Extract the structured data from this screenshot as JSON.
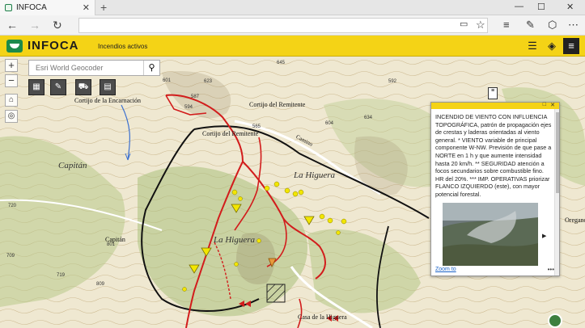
{
  "browser": {
    "tab_title": "INFOCA",
    "tab_close": "✕",
    "new_tab": "+",
    "window_controls": [
      "—",
      "☐",
      "✕"
    ],
    "nav_back": "←",
    "nav_forward": "→",
    "nav_refresh": "↻",
    "url": "",
    "toolbar_icons": [
      "reading-view-icon",
      "favorites-star-icon",
      "hub-icon",
      "notes-icon",
      "share-icon",
      "more-icon"
    ]
  },
  "app": {
    "title": "INFOCA",
    "subtitle": "Incendios activos",
    "accent_color": "#f4d316",
    "logo_color": "#1d8a4a"
  },
  "map": {
    "search_placeholder": "Esri World Geocoder",
    "zoom_in": "+",
    "zoom_out": "−",
    "labels": {
      "cortijo_encarnacion": "Cortijo de la Encarnación",
      "cortijo_remitente_1": "Cortijo del Remitente",
      "cortijo_remitente_2": "Cortijo del Remitente",
      "la_higuera_1": "La Higuera",
      "la_higuera_2": "La Higuera",
      "capitan": "Capitán",
      "capitan_2": "Capitán",
      "capitan_num": "801",
      "casa_higuera": "Casa de la Higuera",
      "oregano": "Oregano",
      "camino": "Camino",
      "n645": "645",
      "n594": "594",
      "n587": "587",
      "n623": "623",
      "n604": "604",
      "n709": "709",
      "n719": "719",
      "n809": "809",
      "n720": "720",
      "n592": "592",
      "n601": "601",
      "n565": "565",
      "n634": "634"
    }
  },
  "popup": {
    "text": "INCENDIO DE VIENTO CON INFLUENCIA TOPOGRÁFICA, patrón de propagación ejes de crestas y laderas orientadas al viento general. * VIENTO variable de principal componente W-NW. Previsión de que pase a NORTE en 1 h y que aumente intensidad hasta 20 km/h. ** SEGURIDAD atención a focos secundarios sobre combustible fino. HR del 20%. *** IMP. OPERATIVAS priorizar FLANCO IZQUIERDO (este), con mayor potencial forestal.",
    "zoom_link": "Zoom to",
    "more": "•••",
    "next_arrow": "▶",
    "min": "□",
    "close": "✕"
  }
}
